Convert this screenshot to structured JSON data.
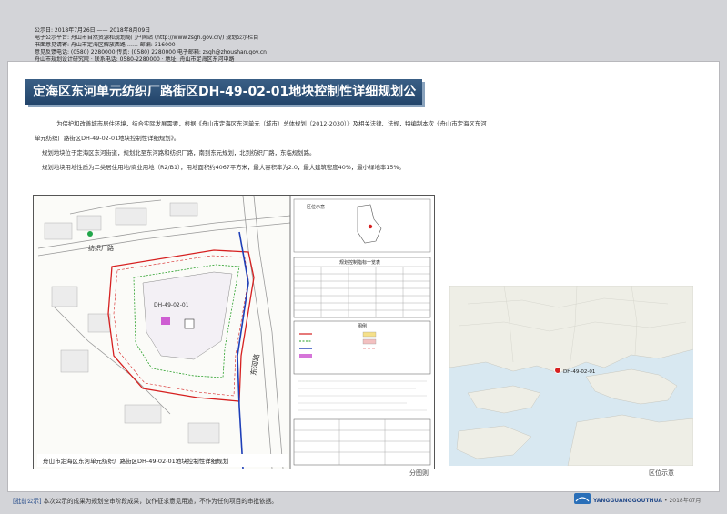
{
  "meta_lines": [
    "公示日: 2018年7月26日  ——  2018年8月09日",
    "电子公示平台: 舟山市自然资源和规划局门户网站 (http://www.zsgh.gov.cn/) 规划公示栏目",
    "书面意见请寄: 舟山市定海区解放西路 …… 邮编: 316000",
    "意见反馈电话: (0580) 2280000   传真: (0580) 2280000   电子邮箱: zsgh@zhoushan.gov.cn",
    "舟山市规划设计研究院 · 联系电话: 0580-2280000 · 地址: 舟山市定海区东河中路"
  ],
  "title": "定海区东河单元纺织厂路街区DH-49-02-01地块控制性详细规划公示",
  "description": [
    "为保护和改善城市居住环境，结合实际发展需要，根据《舟山市定海区东河单元（城市）总体规划（2012-2030）》及相关法律、法规，特编制本次《舟山市定海区东河",
    "单元纺织厂路街区DH-49-02-01地块控制性详细规划》。",
    "规划地块位于定海区东河街道，规划北至东河路和纺织厂路，南到东元规划，北到纺织厂路，东临规划路。",
    "规划地块用地性质为二类居住用地/商业用地（R2/B1），用地面积约4067平方米，最大容积率为2.0，最大建筑密度40%，最小绿地率15%。"
  ],
  "plan": {
    "road_name_1": "纺织厂路",
    "road_name_2": "东河路",
    "site_code": "DH-49-02-01",
    "table_title": "规划控制指标一览表",
    "legend_title": "图例",
    "bottom_caption": "舟山市定海区东河单元纺织厂路街区DH-49-02-01地块控制性详细规划",
    "inset_label": "区位示意",
    "label": "分图则"
  },
  "location_map": {
    "marker_label": "DH-49-02-01",
    "label": "区位示意",
    "accent_color": "#d62020"
  },
  "footer": {
    "note_bracket": "[批前公示]",
    "note": "本次公示的成果为规划全审阶段成果，仅作征求意见用途，不作为任何项目的审批依据。",
    "brand": "YANGGUANGGOUTHUA",
    "date": "• 2018年07月"
  }
}
